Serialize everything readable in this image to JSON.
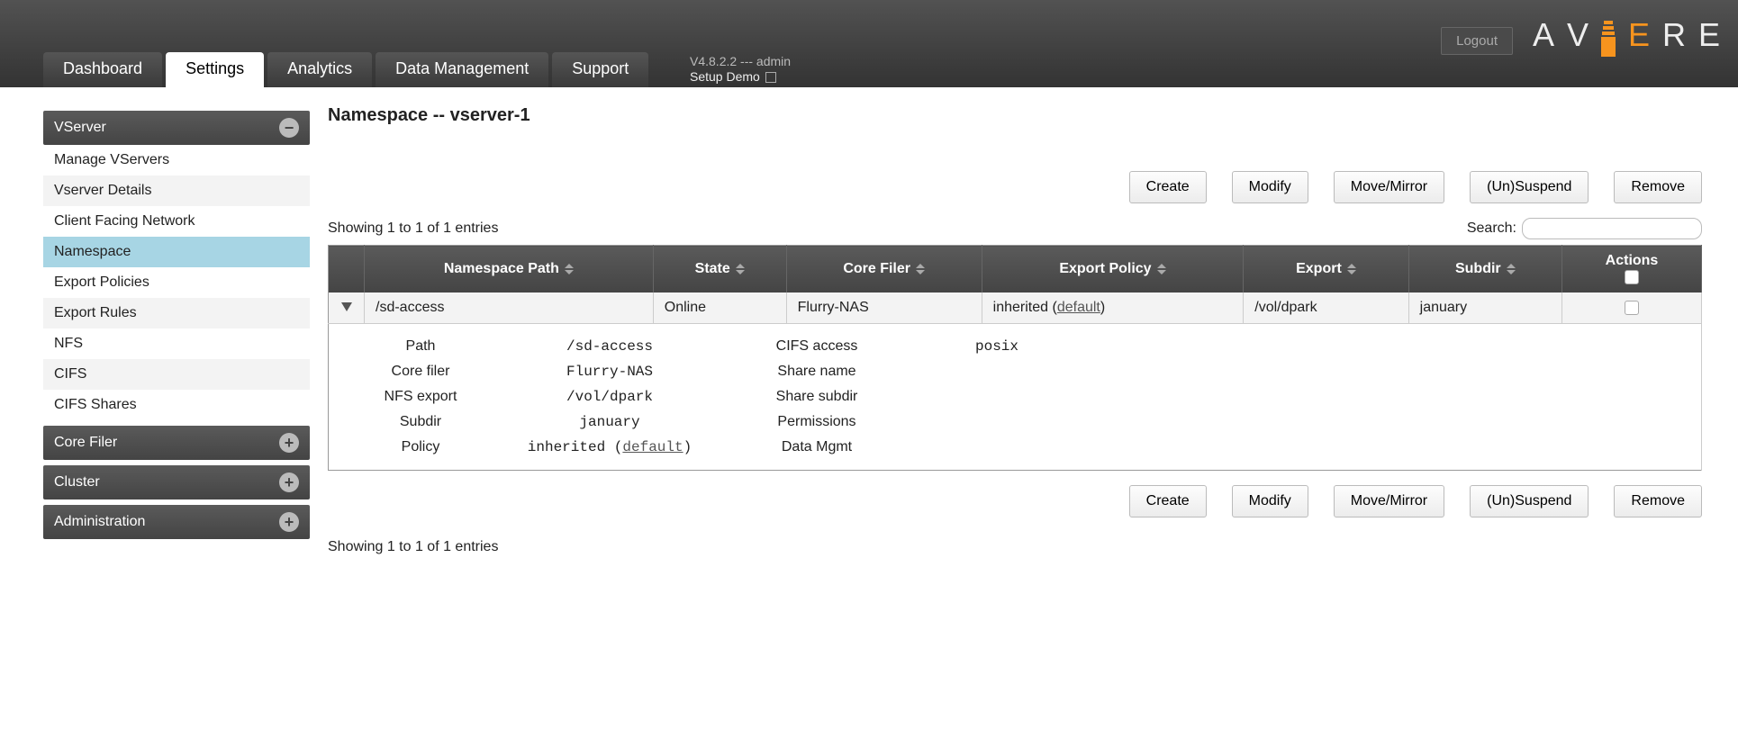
{
  "header": {
    "logout": "Logout",
    "version_line": "V4.8.2.2 --- admin",
    "setup_line": "Setup Demo",
    "logo_letters": [
      "A",
      "V",
      "E",
      "R",
      "E"
    ]
  },
  "tabs": [
    {
      "label": "Dashboard",
      "active": false
    },
    {
      "label": "Settings",
      "active": true
    },
    {
      "label": "Analytics",
      "active": false
    },
    {
      "label": "Data Management",
      "active": false
    },
    {
      "label": "Support",
      "active": false
    }
  ],
  "sidebar": {
    "vserver": {
      "title": "VServer",
      "open": true,
      "items": [
        {
          "label": "Manage VServers",
          "active": false
        },
        {
          "label": "Vserver Details",
          "active": false
        },
        {
          "label": "Client Facing Network",
          "active": false
        },
        {
          "label": "Namespace",
          "active": true
        },
        {
          "label": "Export Policies",
          "active": false
        },
        {
          "label": "Export Rules",
          "active": false
        },
        {
          "label": "NFS",
          "active": false
        },
        {
          "label": "CIFS",
          "active": false
        },
        {
          "label": "CIFS Shares",
          "active": false
        }
      ]
    },
    "core_filer": {
      "title": "Core Filer",
      "open": false
    },
    "cluster": {
      "title": "Cluster",
      "open": false
    },
    "administration": {
      "title": "Administration",
      "open": false
    }
  },
  "main": {
    "title": "Namespace -- vserver-1",
    "buttons": {
      "create": "Create",
      "modify": "Modify",
      "move_mirror": "Move/Mirror",
      "suspend": "(Un)Suspend",
      "remove": "Remove"
    },
    "showing_top": "Showing 1 to 1 of 1 entries",
    "showing_bottom": "Showing 1 to 1 of 1 entries",
    "search_label": "Search:",
    "columns": {
      "path": "Namespace Path",
      "state": "State",
      "core_filer": "Core Filer",
      "export_policy": "Export Policy",
      "export": "Export",
      "subdir": "Subdir",
      "actions": "Actions"
    },
    "row": {
      "path": "/sd-access",
      "state": "Online",
      "core_filer": "Flurry-NAS",
      "export_policy_prefix": "inherited (",
      "export_policy_link": "default",
      "export_policy_suffix": ")",
      "export": "/vol/dpark",
      "subdir": "january"
    },
    "details": {
      "labels": {
        "path": "Path",
        "core_filer": "Core filer",
        "nfs_export": "NFS export",
        "subdir": "Subdir",
        "policy": "Policy",
        "cifs_access": "CIFS access",
        "share_name": "Share name",
        "share_subdir": "Share subdir",
        "permissions": "Permissions",
        "data_mgmt": "Data Mgmt"
      },
      "values": {
        "path": "/sd-access",
        "core_filer": "Flurry-NAS",
        "nfs_export": "/vol/dpark",
        "subdir": "january",
        "policy_prefix": "inherited (",
        "policy_link": "default",
        "policy_suffix": ")",
        "cifs_access": "posix",
        "share_name": "",
        "share_subdir": "",
        "permissions": "",
        "data_mgmt": ""
      }
    }
  }
}
